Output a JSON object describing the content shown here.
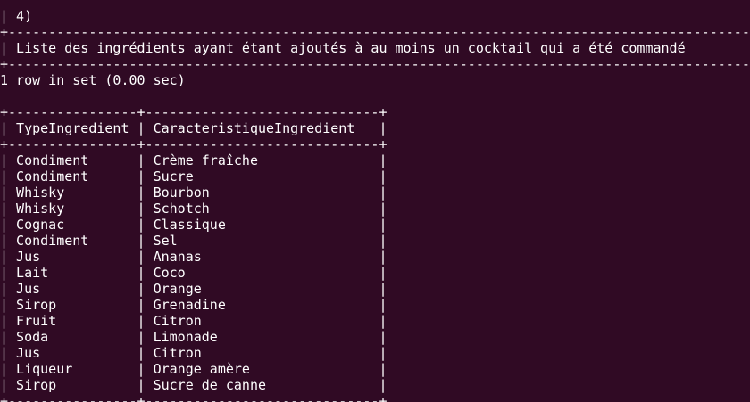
{
  "terminal": {
    "lines": [
      "| 4)                                                                                                                    |",
      "+------------------------------------------------------------------------------------------------------------------------+",
      "| Liste des ingrédients ayant étant ajoutés à au moins un cocktail qui a été commandé                                    |",
      "+------------------------------------------------------------------------------------------------------------------------+",
      "1 row in set (0.00 sec)",
      "",
      "+----------------+-----------------------------+",
      "| TypeIngredient | CaracteristiqueIngredient   |",
      "+----------------+-----------------------------+",
      "| Condiment      | Crème fraîche               |",
      "| Condiment      | Sucre                       |",
      "| Whisky         | Bourbon                     |",
      "| Whisky         | Schotch                     |",
      "| Cognac         | Classique                   |",
      "| Condiment      | Sel                         |",
      "| Jus            | Ananas                      |",
      "| Lait           | Coco                        |",
      "| Jus            | Orange                      |",
      "| Sirop          | Grenadine                   |",
      "| Fruit          | Citron                      |",
      "| Soda           | Limonade                    |",
      "| Jus            | Citron                      |",
      "| Liqueur        | Orange amère                |",
      "| Sirop          | Sucre de canne              |",
      "+----------------+-----------------------------+"
    ]
  }
}
